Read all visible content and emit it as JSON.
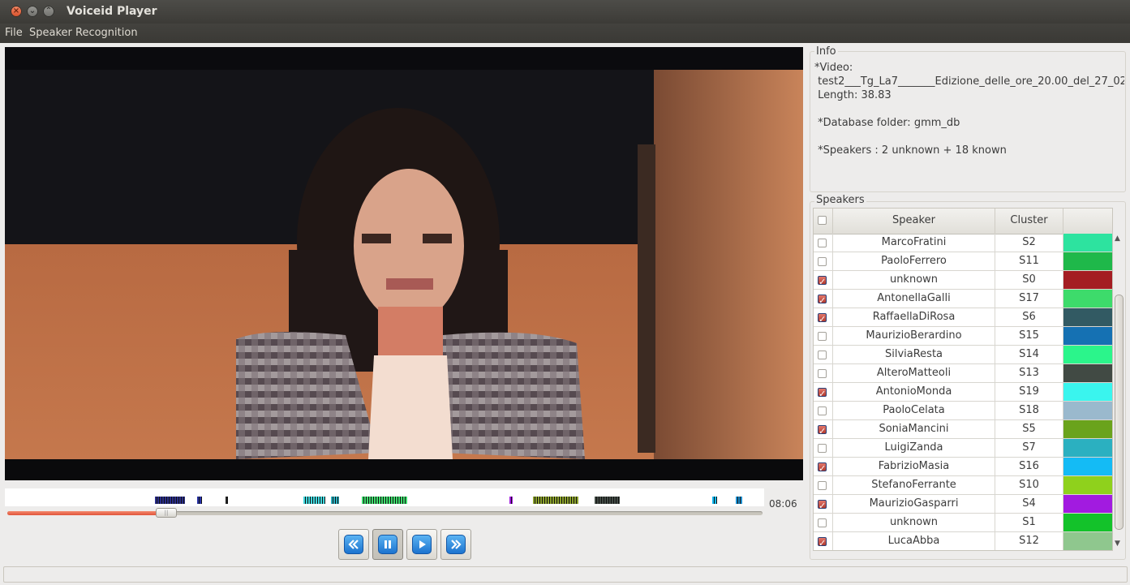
{
  "window": {
    "title": "Voiceid Player",
    "buttons": [
      "close-icon",
      "minimize-icon",
      "maximize-icon"
    ]
  },
  "menu": [
    "File",
    "Speaker Recognition"
  ],
  "player": {
    "time": "08:06",
    "progress": 0.21,
    "controls": [
      {
        "name": "rewind-button",
        "icon": "rewind-icon"
      },
      {
        "name": "pause-button",
        "icon": "pause-icon",
        "active": true
      },
      {
        "name": "play-button",
        "icon": "play-icon"
      },
      {
        "name": "fast-forward-button",
        "icon": "fast-forward-icon"
      }
    ]
  },
  "info": {
    "title": "Info",
    "lines": [
      "*Video:",
      " test2___Tg_La7_______Edizione_delle_ore_20.00_del_27_02",
      " Length: 38.83",
      "",
      " *Database folder: gmm_db",
      "",
      " *Speakers : 2 unknown + 18 known"
    ]
  },
  "speakers": {
    "title": "Speakers",
    "columns": {
      "speaker": "Speaker",
      "cluster": "Cluster"
    },
    "rows": [
      {
        "name": "MarcoFratini",
        "cluster": "S2",
        "color": "#2de39f",
        "checked": false
      },
      {
        "name": "PaoloFerrero",
        "cluster": "S11",
        "color": "#1fb84a",
        "checked": false
      },
      {
        "name": "unknown",
        "cluster": "S0",
        "color": "#a41d22",
        "checked": true
      },
      {
        "name": "AntonellaGalli",
        "cluster": "S17",
        "color": "#3ddb6b",
        "checked": true
      },
      {
        "name": "RaffaellaDiRosa",
        "cluster": "S6",
        "color": "#325a63",
        "checked": true
      },
      {
        "name": "MaurizioBerardino",
        "cluster": "S15",
        "color": "#1571b3",
        "checked": false
      },
      {
        "name": "SilviaResta",
        "cluster": "S14",
        "color": "#2bf58b",
        "checked": false
      },
      {
        "name": "AlteroMatteoli",
        "cluster": "S13",
        "color": "#414a44",
        "checked": false
      },
      {
        "name": "AntonioMonda",
        "cluster": "S19",
        "color": "#3af5ee",
        "checked": true
      },
      {
        "name": "PaoloCelata",
        "cluster": "S18",
        "color": "#9ab9cd",
        "checked": false
      },
      {
        "name": "SoniaMancini",
        "cluster": "S5",
        "color": "#6aa31c",
        "checked": true
      },
      {
        "name": "LuigiZanda",
        "cluster": "S7",
        "color": "#2bb0c0",
        "checked": false
      },
      {
        "name": "FabrizioMasia",
        "cluster": "S16",
        "color": "#14bbf5",
        "checked": true
      },
      {
        "name": "StefanoFerrante",
        "cluster": "S10",
        "color": "#8fd11c",
        "checked": false
      },
      {
        "name": "MaurizioGasparri",
        "cluster": "S4",
        "color": "#a21be0",
        "checked": true
      },
      {
        "name": "unknown",
        "cluster": "S1",
        "color": "#13c22a",
        "checked": false
      },
      {
        "name": "LucaAbba",
        "cluster": "S12",
        "color": "#8fc78e",
        "checked": true
      }
    ]
  },
  "timeline": [
    {
      "start": 0.198,
      "end": 0.238,
      "color": "#2a2d8a"
    },
    {
      "start": 0.253,
      "end": 0.259,
      "color": "#2832a6"
    },
    {
      "start": 0.291,
      "end": 0.294,
      "color": "#222"
    },
    {
      "start": 0.393,
      "end": 0.422,
      "color": "#3fd6dc"
    },
    {
      "start": 0.429,
      "end": 0.44,
      "color": "#2bb0c0"
    },
    {
      "start": 0.47,
      "end": 0.53,
      "color": "#3ddb6b"
    },
    {
      "start": 0.664,
      "end": 0.668,
      "color": "#a21be0"
    },
    {
      "start": 0.695,
      "end": 0.755,
      "color": "#8aa02a"
    },
    {
      "start": 0.777,
      "end": 0.81,
      "color": "#414a44"
    },
    {
      "start": 0.932,
      "end": 0.938,
      "color": "#14bbf5"
    },
    {
      "start": 0.963,
      "end": 0.972,
      "color": "#1c8fd0"
    }
  ]
}
